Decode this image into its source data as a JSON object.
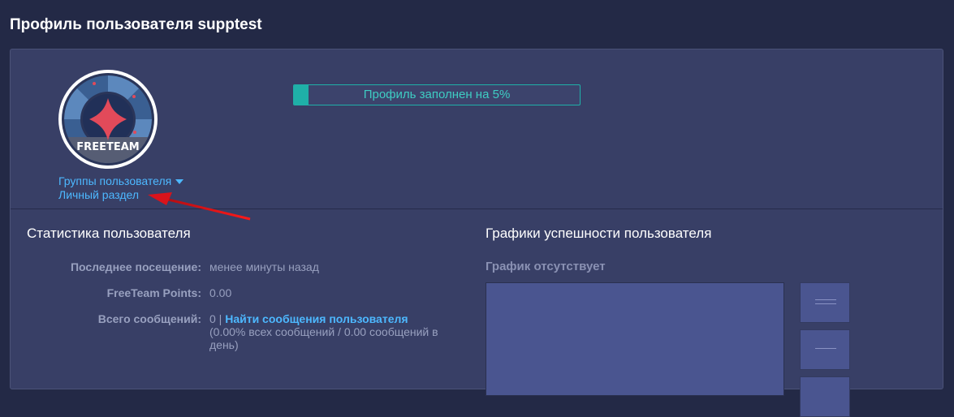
{
  "header": {
    "title": "Профиль пользователя supptest"
  },
  "profile": {
    "avatar_text": "FREETEAM",
    "groups_link": "Группы пользователя",
    "personal_link": "Личный раздел",
    "completion_label": "Профиль заполнен на 5%",
    "completion_percent": 5
  },
  "stats": {
    "title": "Статистика пользователя",
    "rows": [
      {
        "label": "Последнее посещение:",
        "value": "менее минуты назад"
      },
      {
        "label": "FreeTeam Points:",
        "value": "0.00"
      },
      {
        "label": "Всего сообщений:",
        "value_prefix": "0 | ",
        "link": "Найти сообщения пользователя",
        "note": "(0.00% всех сообщений / 0.00 сообщений в день)"
      }
    ]
  },
  "graphs": {
    "title": "Графики успешности пользователя",
    "empty_label": "График отсутствует"
  },
  "icons": {
    "avatar": "freeteam-logo-icon",
    "caret": "caret-down-icon",
    "annotation": "red-arrow-icon"
  },
  "colors": {
    "background": "#232946",
    "panel": "#383f66",
    "link": "#4db8ff",
    "progress": "#1fb0a8",
    "arrow": "#e3131b"
  }
}
